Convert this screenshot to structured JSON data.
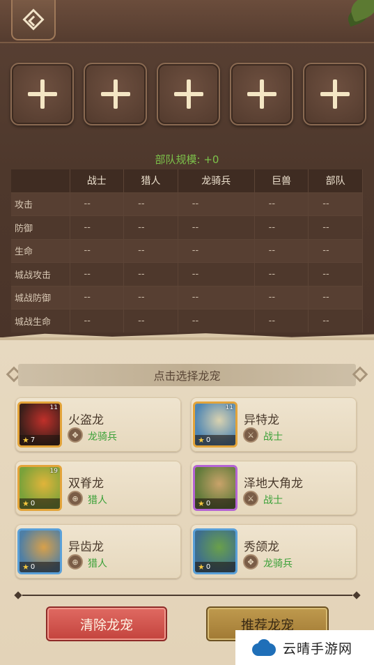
{
  "header": {
    "back_icon": "diamond-back-icon"
  },
  "slots": [
    "+",
    "+",
    "+",
    "+",
    "+"
  ],
  "troop_scale": "部队规模: +0",
  "stats_table": {
    "columns": [
      "",
      "战士",
      "猎人",
      "龙骑兵",
      "巨兽",
      "部队"
    ],
    "rows": [
      {
        "label": "攻击",
        "values": [
          "--",
          "--",
          "--",
          "--",
          "--"
        ]
      },
      {
        "label": "防御",
        "values": [
          "--",
          "--",
          "--",
          "--",
          "--"
        ]
      },
      {
        "label": "生命",
        "values": [
          "--",
          "--",
          "--",
          "--",
          "--"
        ]
      },
      {
        "label": "城战攻击",
        "values": [
          "--",
          "--",
          "--",
          "--",
          "--"
        ]
      },
      {
        "label": "城战防御",
        "values": [
          "--",
          "--",
          "--",
          "--",
          "--"
        ]
      },
      {
        "label": "城战生命",
        "values": [
          "--",
          "--",
          "--",
          "--",
          "--"
        ]
      }
    ]
  },
  "select_banner": "点击选择龙宠",
  "pets": [
    {
      "name": "火盗龙",
      "type": "龙骑兵",
      "level": "11",
      "stars": "7",
      "frame": "orange",
      "colors": [
        "#3a1f1a",
        "#c0302a"
      ]
    },
    {
      "name": "异特龙",
      "type": "战士",
      "level": "11",
      "stars": "0",
      "frame": "orange",
      "colors": [
        "#4f86b3",
        "#d9d2b0"
      ]
    },
    {
      "name": "双脊龙",
      "type": "猎人",
      "level": "19",
      "stars": "0",
      "frame": "orange",
      "colors": [
        "#7aa23a",
        "#e0b43a"
      ]
    },
    {
      "name": "泽地大角龙",
      "type": "战士",
      "level": "",
      "stars": "0",
      "frame": "purple",
      "colors": [
        "#5f7a3a",
        "#c9a36a"
      ]
    },
    {
      "name": "异齿龙",
      "type": "猎人",
      "level": "",
      "stars": "0",
      "frame": "blue",
      "colors": [
        "#4e7fa6",
        "#d8a04a"
      ]
    },
    {
      "name": "秀颌龙",
      "type": "龙骑兵",
      "level": "",
      "stars": "0",
      "frame": "blue",
      "colors": [
        "#3d6e8e",
        "#6aa04a"
      ]
    }
  ],
  "buttons": {
    "clear": "清除龙宠",
    "recommend": "推荐龙宠"
  },
  "watermark": "云晴手游网",
  "colors": {
    "positive_green": "#7cc24a",
    "type_green": "#3aa037",
    "clear_red": "#c3433d",
    "recommend_gold": "#a17a34"
  }
}
